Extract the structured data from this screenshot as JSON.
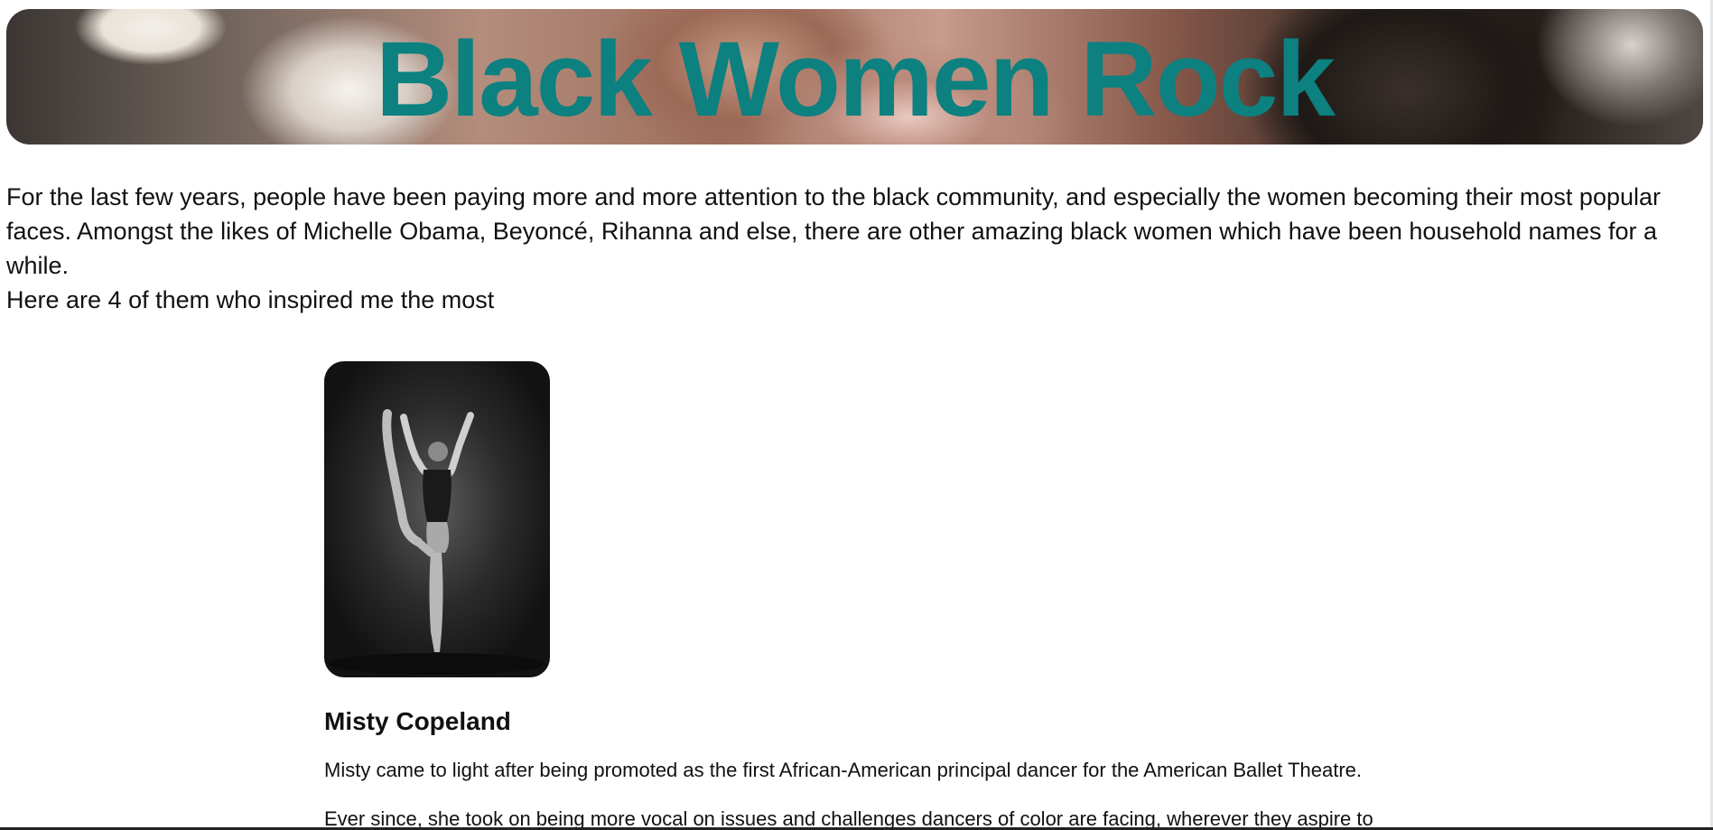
{
  "header": {
    "title": "Black Women Rock",
    "title_color": "#0d8080"
  },
  "intro": {
    "paragraph": "For the last few years, people have been paying more and more attention to the black community, and especially the women becoming their most popular faces. Amongst the likes of Michelle Obama, Beyoncé, Rihanna and else, there are other amazing black women which have been household names for a while.",
    "lead": "Here are 4 of them who inspired me the most"
  },
  "cards": [
    {
      "name": "Misty Copeland",
      "image": "ballet-dancer-photo",
      "text": "Misty came to light after being promoted as the first African-American principal dancer for the American Ballet Theatre.",
      "text2": "Ever since, she took on being more vocal on issues and challenges dancers of color are facing, wherever they aspire to"
    }
  ]
}
